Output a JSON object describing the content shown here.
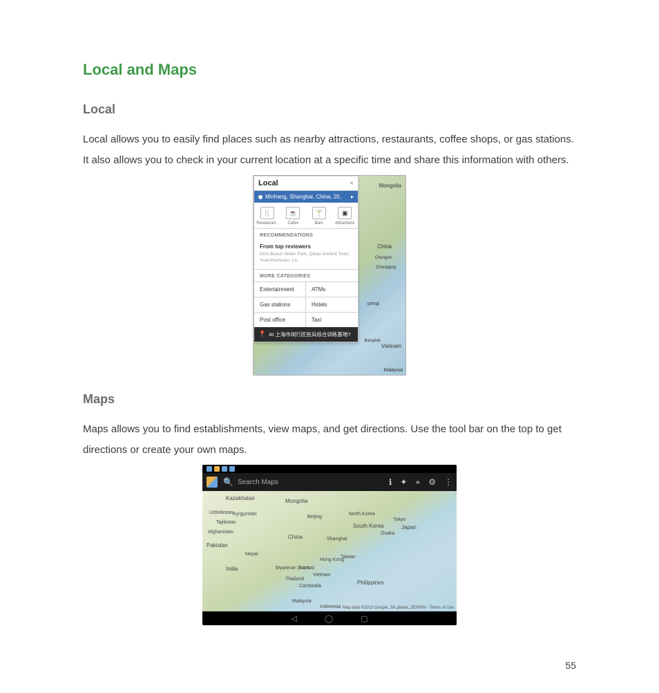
{
  "page": {
    "number": "55",
    "heading": "Local and Maps",
    "sections": {
      "local": {
        "heading": "Local",
        "body": "Local allows you to easily find places such as nearby attractions, restaurants, coffee shops, or gas stations. It also allows you to check in your current location at a specific time and share this information with others."
      },
      "maps": {
        "heading": "Maps",
        "body": "Maps allows you to find establishments, view maps, and get directions. Use the tool bar on the top to get directions or create your own maps."
      }
    }
  },
  "figure1": {
    "panel_title": "Local",
    "close_glyph": "×",
    "location_text": "Minhang, Shanghai, China, 20..",
    "location_chevron": "▸",
    "categories": [
      {
        "label": "Restauran..",
        "glyph": "🍴"
      },
      {
        "label": "Cafes",
        "glyph": "☕"
      },
      {
        "label": "Bars",
        "glyph": "🍸"
      },
      {
        "label": "Attractions",
        "glyph": "▣"
      }
    ],
    "recommendations_label": "RECOMMENDATIONS",
    "recommendation": {
      "title": "From top reviewers",
      "subtitle": "Dino Beach Water Park, Qibao Ancient Town, Yuanzhenxuan, La.."
    },
    "more_label": "MORE CATEGORIES",
    "more_categories": [
      "Entertainment",
      "ATMs",
      "Gas stations",
      "Hotels",
      "Post office",
      "Taxi"
    ],
    "footer_text": "At 上海市闵行区民兵综合训练基地?",
    "map_labels": {
      "mongolia": "Mongolia",
      "china": "China",
      "chengdu": "Chengdu",
      "chongqing": "Chongqing",
      "urmqi": "urmqi",
      "bangkok": "Bangkok",
      "vietnam": "Vietnam",
      "malaysia": "Malaysia"
    }
  },
  "figure2": {
    "search_placeholder": "Search Maps",
    "toolbar_icons": {
      "info": "ℹ",
      "layers": "✦",
      "location": "⌖",
      "settings": "⚙",
      "menu": "⋮"
    },
    "nav_icons": {
      "back": "◁",
      "home": "◯",
      "recent": "▢"
    },
    "attrib": "Map data ©2013 Google, SK planet, ZENRIN - Terms of Use",
    "map_labels": {
      "kazakhstan": "Kazakhstan",
      "mongolia": "Mongolia",
      "uzbekistan": "Uzbekistan",
      "kyrgyzstan": "Kyrgyzstan",
      "tajikistan": "Tajikistan",
      "afghanistan": "Afghanistan",
      "pakistan": "Pakistan",
      "nepal": "Nepal",
      "india": "India",
      "china": "China",
      "north_korea": "North Korea",
      "south_korea": "South Korea",
      "japan": "Japan",
      "myanmar": "Myanmar (Burma)",
      "thailand": "Thailand",
      "laos": "Laos",
      "vietnam": "Vietnam",
      "cambodia": "Cambodia",
      "philippines": "Philippines",
      "taiwan": "Taiwan",
      "malaysia": "Malaysia",
      "indonesia": "Indonesia",
      "beijing": "Beijing",
      "shanghai": "Shanghai",
      "hongkong": "Hong Kong",
      "tokyo": "Tokyo",
      "osaka": "Osaka"
    }
  }
}
